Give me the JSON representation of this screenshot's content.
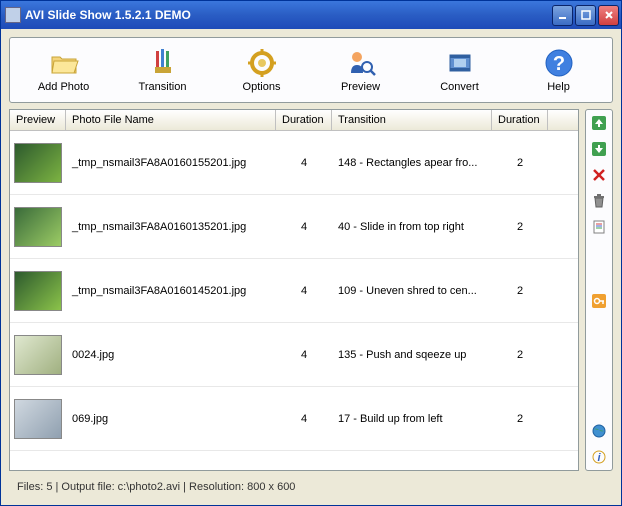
{
  "window": {
    "title": "AVI Slide Show 1.5.2.1 DEMO"
  },
  "toolbar": [
    {
      "name": "add-photo",
      "label": "Add Photo"
    },
    {
      "name": "transition",
      "label": "Transition"
    },
    {
      "name": "options",
      "label": "Options"
    },
    {
      "name": "preview",
      "label": "Preview"
    },
    {
      "name": "convert",
      "label": "Convert"
    },
    {
      "name": "help",
      "label": "Help"
    }
  ],
  "columns": {
    "preview": "Preview",
    "name": "Photo File Name",
    "dur1": "Duration",
    "trans": "Transition",
    "dur2": "Duration"
  },
  "rows": [
    {
      "file": "_tmp_nsmail3FA8A0160155201.jpg",
      "dur1": "4",
      "trans": "148 - Rectangles apear fro...",
      "dur2": "2"
    },
    {
      "file": "_tmp_nsmail3FA8A0160135201.jpg",
      "dur1": "4",
      "trans": "40 - Slide in from top right",
      "dur2": "2"
    },
    {
      "file": "_tmp_nsmail3FA8A0160145201.jpg",
      "dur1": "4",
      "trans": "109 - Uneven shred to cen...",
      "dur2": "2"
    },
    {
      "file": "0024.jpg",
      "dur1": "4",
      "trans": "135 - Push and sqeeze up",
      "dur2": "2"
    },
    {
      "file": "069.jpg",
      "dur1": "4",
      "trans": "17 - Build up from left",
      "dur2": "2"
    }
  ],
  "status": "Files: 5 | Output file: c:\\photo2.avi | Resolution: 800 x 600"
}
